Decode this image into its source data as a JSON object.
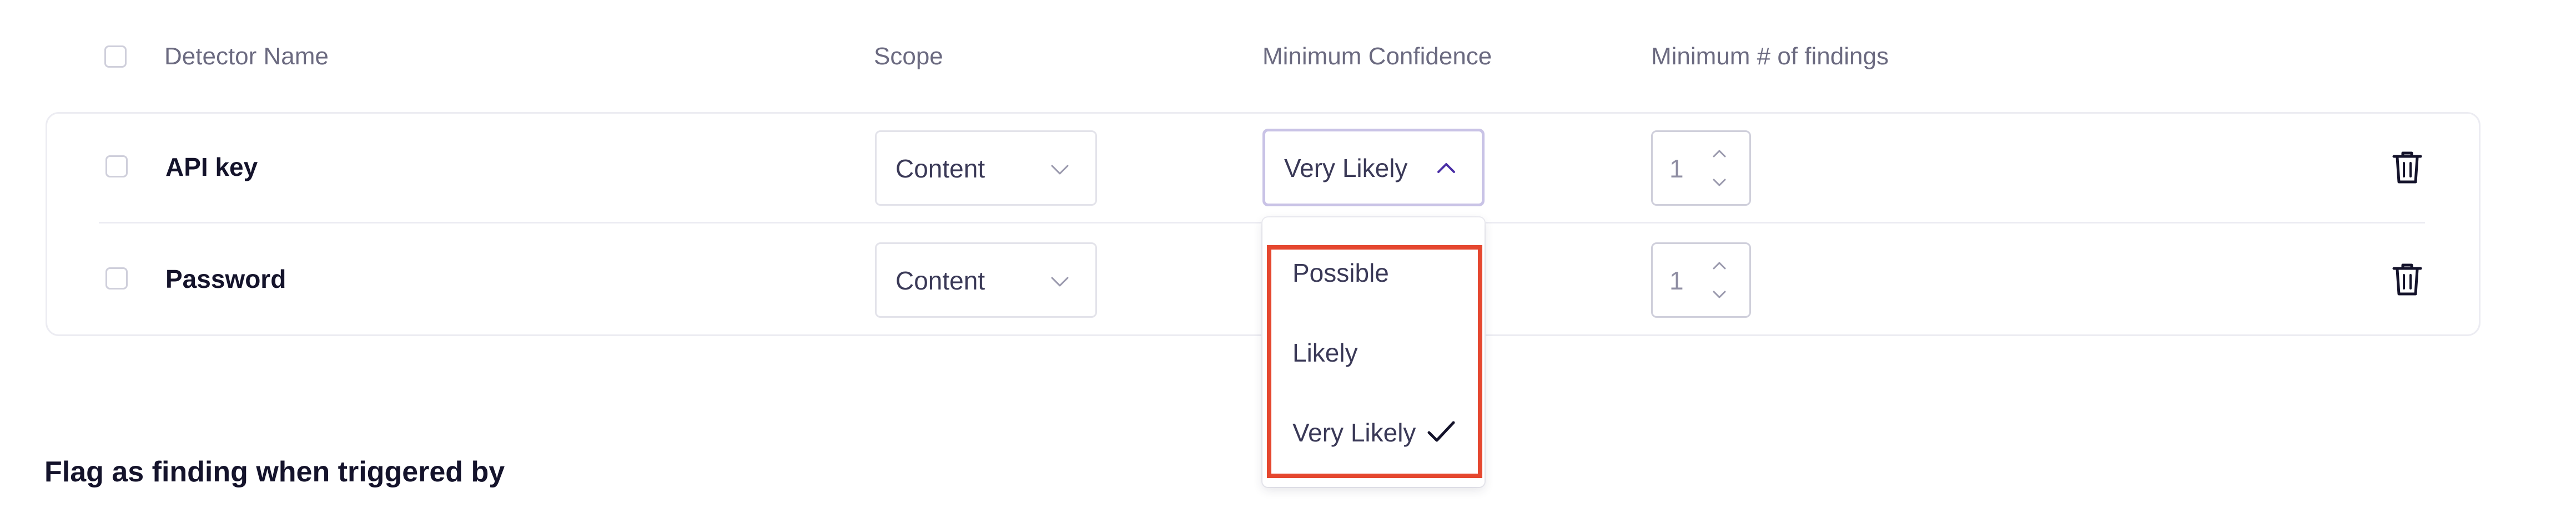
{
  "table": {
    "headers": {
      "detector_name": "Detector Name",
      "scope": "Scope",
      "minimum_confidence": "Minimum Confidence",
      "minimum_findings": "Minimum # of findings"
    },
    "rows": [
      {
        "name": "API key",
        "scope": "Content",
        "confidence": "Very Likely",
        "min_findings": "1"
      },
      {
        "name": "Password",
        "scope": "Content",
        "min_findings": "1"
      }
    ]
  },
  "confidence_dropdown": {
    "options": [
      "Possible",
      "Likely",
      "Very Likely"
    ],
    "selected": "Very Likely"
  },
  "section": {
    "title": "Flag as finding when triggered by"
  },
  "colors": {
    "highlight": "#e5472f",
    "accent": "#4b2fa6"
  },
  "icons": {
    "delete": "trash-icon",
    "expand": "chevron-down-icon",
    "collapse": "chevron-up-icon",
    "selected": "checkmark-icon"
  }
}
